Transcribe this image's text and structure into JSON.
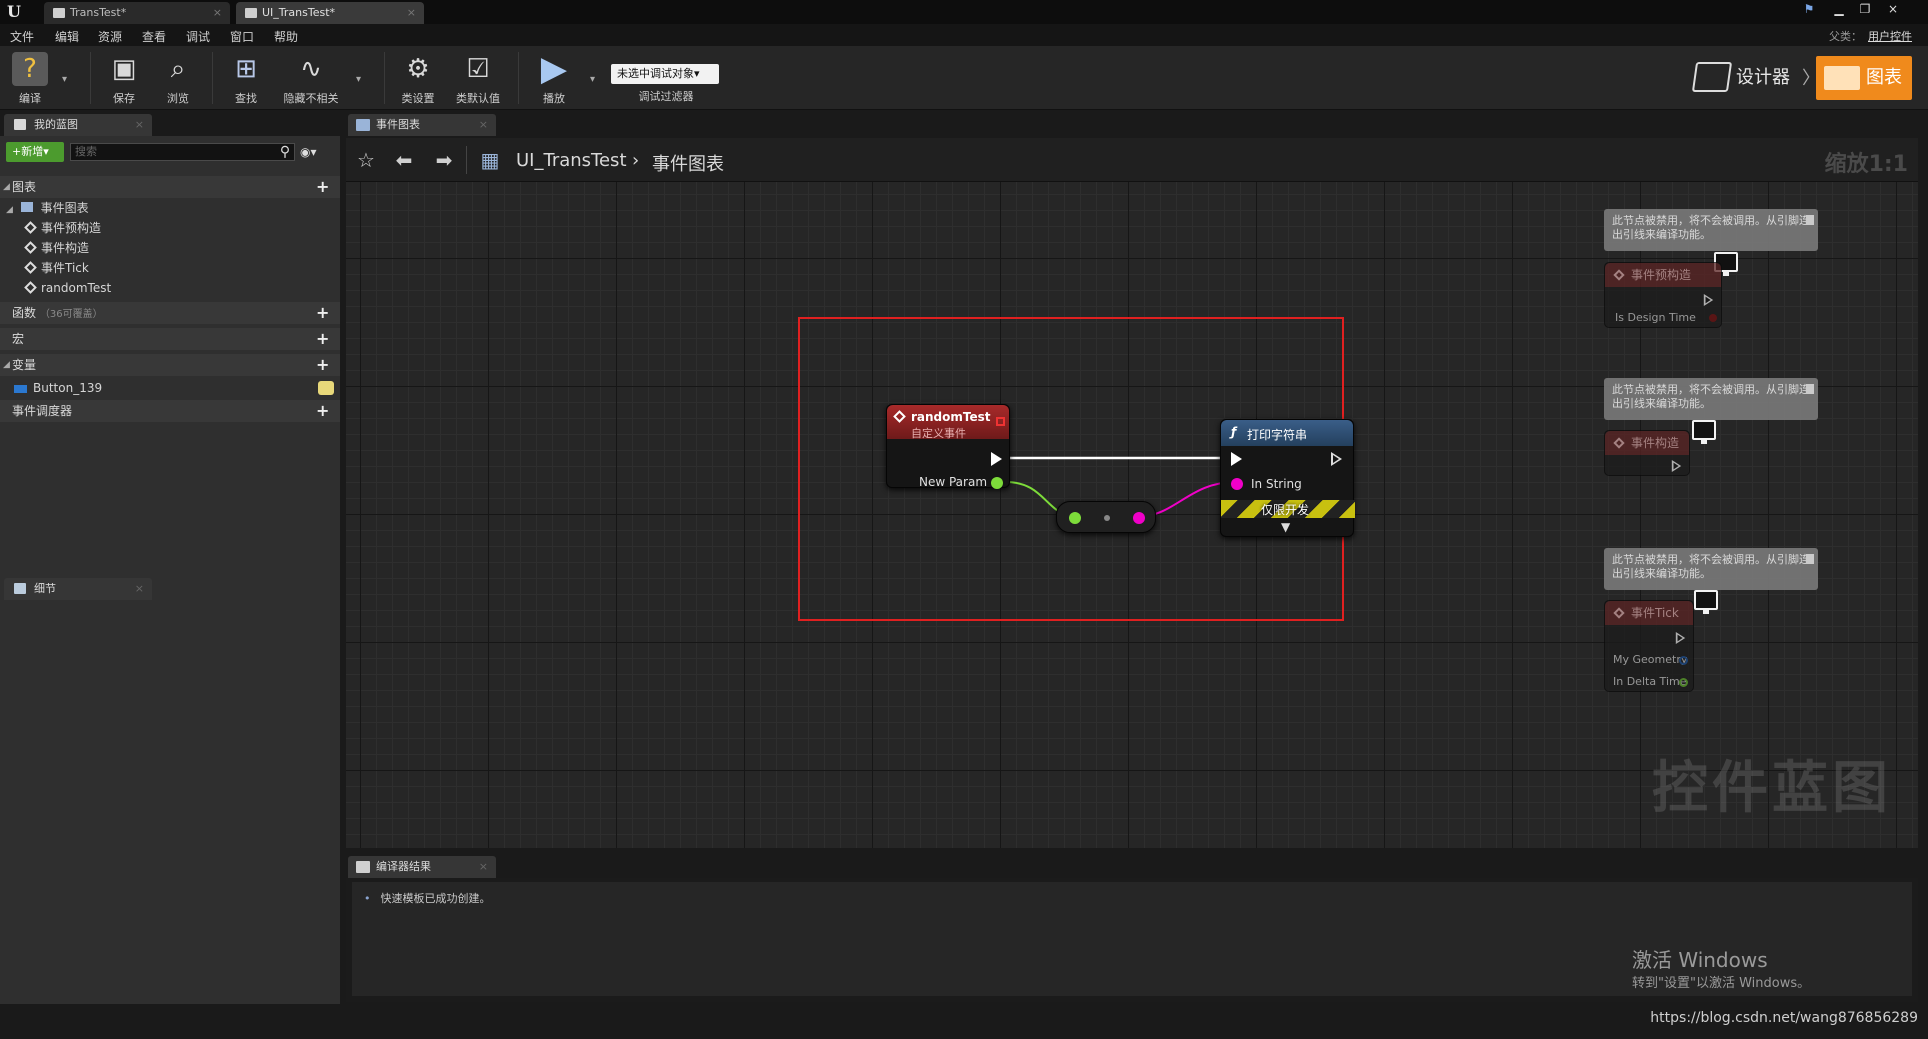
{
  "window": {
    "tabs": [
      {
        "label": "TransTest*"
      },
      {
        "label": "UI_TransTest*"
      }
    ],
    "close_glyph": "×"
  },
  "menu": {
    "items": [
      "文件",
      "编辑",
      "资源",
      "查看",
      "调试",
      "窗口",
      "帮助"
    ],
    "parent_label": "父类：",
    "parent_value": "用户控件"
  },
  "toolbar": {
    "buttons": [
      {
        "label": "编译",
        "icon": "compile-icon"
      },
      {
        "label": "保存",
        "icon": "save-icon"
      },
      {
        "label": "浏览",
        "icon": "browse-icon"
      },
      {
        "label": "查找",
        "icon": "find-icon"
      },
      {
        "label": "隐藏不相关",
        "icon": "hide-unrelated-icon"
      },
      {
        "label": "类设置",
        "icon": "class-settings-icon"
      },
      {
        "label": "类默认值",
        "icon": "class-defaults-icon"
      },
      {
        "label": "播放",
        "icon": "play-icon"
      }
    ],
    "debug_object": "未选中调试对象▾",
    "debug_filter_label": "调试过滤器",
    "mode_designer": "设计器",
    "mode_graph": "图表"
  },
  "my_blueprint": {
    "tab_label": "我的蓝图",
    "new_button": "新增",
    "search_placeholder": "搜索",
    "sections": {
      "graphs": "图表",
      "functions": "函数",
      "functions_sub": "（36可覆盖）",
      "macros": "宏",
      "variables": "变量",
      "event_dispatchers": "事件调度器"
    },
    "graph_tree": {
      "event_graph": "事件图表",
      "events": [
        "事件预构造",
        "事件构造",
        "事件Tick",
        "randomTest"
      ]
    },
    "variables": [
      "Button_139"
    ]
  },
  "details": {
    "tab_label": "细节"
  },
  "graph": {
    "tab_label": "事件图表",
    "breadcrumb_root": "UI_TransTest",
    "breadcrumb_sep": "›",
    "breadcrumb_current": "事件图表",
    "zoom": "缩放1:1",
    "watermark": "控件蓝图",
    "nodes": {
      "custom_event": {
        "title": "randomTest",
        "subtitle": "自定义事件",
        "param": "New Param"
      },
      "print_string": {
        "title": "打印字符串",
        "pin": "In String",
        "dev_only": "仅限开发"
      }
    },
    "disabled_note": "此节点被禁用，将不会被调用。从引脚连出引线来编译功能。",
    "disabled_nodes": [
      {
        "title": "事件预构造",
        "pins": [
          "Is Design Time"
        ]
      },
      {
        "title": "事件构造",
        "pins": []
      },
      {
        "title": "事件Tick",
        "pins": [
          "My Geometry",
          "In Delta Time"
        ]
      }
    ],
    "colors": {
      "exec": "#ffffff",
      "string_pin": "#f000c8",
      "struct_pin": "#7ddc3a",
      "selection": "#e02020"
    }
  },
  "compiler": {
    "tab_label": "编译器结果",
    "log": [
      "快速模板已成功创建。"
    ]
  },
  "overlay": {
    "activate_title": "激活 Windows",
    "activate_sub": "转到\"设置\"以激活 Windows。",
    "url": "https://blog.csdn.net/wang876856289"
  }
}
